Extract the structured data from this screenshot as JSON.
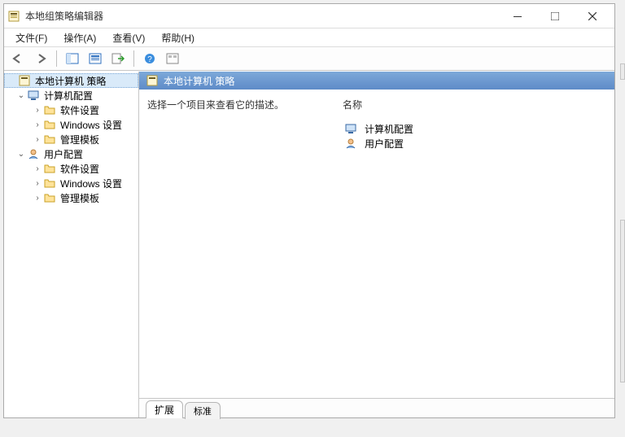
{
  "window": {
    "title": "本地组策略编辑器"
  },
  "menubar": {
    "items": [
      {
        "label": "文件(F)"
      },
      {
        "label": "操作(A)"
      },
      {
        "label": "查看(V)"
      },
      {
        "label": "帮助(H)"
      }
    ]
  },
  "tree": {
    "root": {
      "label": "本地计算机 策略"
    },
    "nodes": [
      {
        "label": "计算机配置",
        "children": [
          {
            "label": "软件设置"
          },
          {
            "label": "Windows 设置"
          },
          {
            "label": "管理模板"
          }
        ]
      },
      {
        "label": "用户配置",
        "children": [
          {
            "label": "软件设置"
          },
          {
            "label": "Windows 设置"
          },
          {
            "label": "管理模板"
          }
        ]
      }
    ]
  },
  "content": {
    "header": "本地计算机 策略",
    "description": "选择一个项目来查看它的描述。",
    "list_header": "名称",
    "items": [
      {
        "label": "计算机配置"
      },
      {
        "label": "用户配置"
      }
    ]
  },
  "tabs": {
    "primary": "扩展",
    "secondary": "标准"
  }
}
